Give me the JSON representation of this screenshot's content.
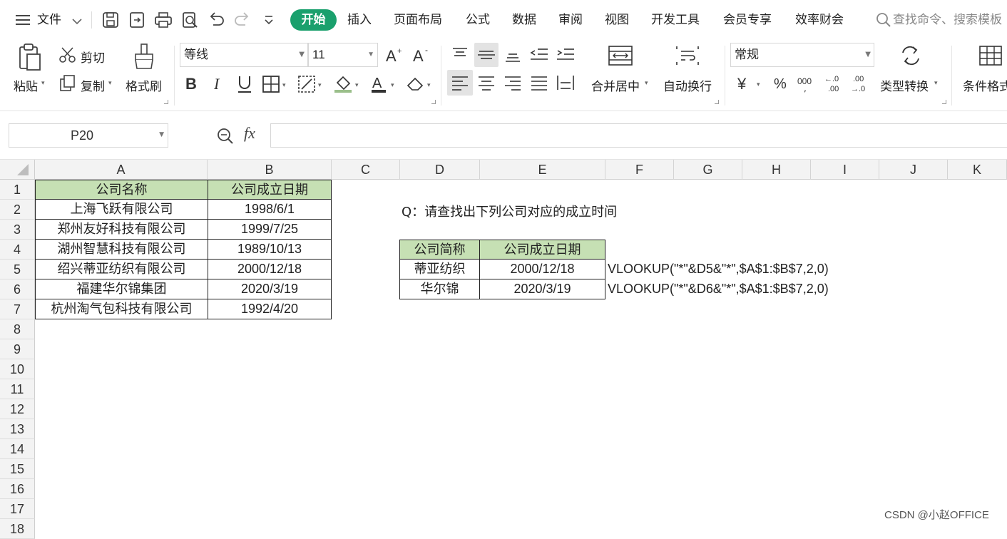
{
  "menu": {
    "file_label": "文件",
    "tabs": [
      "开始",
      "插入",
      "页面布局",
      "公式",
      "数据",
      "审阅",
      "视图",
      "开发工具",
      "会员专享",
      "效率财会"
    ],
    "search_placeholder": "查找命令、搜索模板"
  },
  "ribbon": {
    "paste": "粘贴",
    "cut": "剪切",
    "copy": "复制",
    "format_painter": "格式刷",
    "font_name": "等线",
    "font_size": "11",
    "merge_center": "合并居中",
    "wrap_text": "自动换行",
    "number_format": "常规",
    "type_convert": "类型转换",
    "conditional_format": "条件格式"
  },
  "formula_bar": {
    "name_box": "P20",
    "fx_label": "fx",
    "formula": ""
  },
  "sheet": {
    "columns": [
      "A",
      "B",
      "C",
      "D",
      "E",
      "F",
      "G",
      "H",
      "I",
      "J",
      "K"
    ],
    "rows": [
      "1",
      "2",
      "3",
      "4",
      "5",
      "6",
      "7",
      "8",
      "9",
      "10",
      "11",
      "12",
      "13",
      "14",
      "15",
      "16",
      "17",
      "18"
    ],
    "table1": {
      "headers": [
        "公司名称",
        "公司成立日期"
      ],
      "rows": [
        [
          "上海飞跃有限公司",
          "1998/6/1"
        ],
        [
          "郑州友好科技有限公司",
          "1999/7/25"
        ],
        [
          "湖州智慧科技有限公司",
          "1989/10/13"
        ],
        [
          "绍兴蒂亚纺织有限公司",
          "2000/12/18"
        ],
        [
          "福建华尔锦集团",
          "2020/3/19"
        ],
        [
          "杭州淘气包科技有限公司",
          "1992/4/20"
        ]
      ]
    },
    "question": "Q：请查找出下列公司对应的成立时间",
    "table2": {
      "headers": [
        "公司简称",
        "公司成立日期"
      ],
      "rows": [
        [
          "蒂亚纺织",
          "2000/12/18",
          "VLOOKUP(\"*\"&D5&\"*\",$A$1:$B$7,2,0)"
        ],
        [
          "华尔锦",
          "2020/3/19",
          "VLOOKUP(\"*\"&D6&\"*\",$A$1:$B$7,2,0)"
        ]
      ]
    },
    "header_fill": "#c6e0b4"
  },
  "watermark": "CSDN @小赵OFFICE",
  "colors": {
    "accent": "#1aa06d"
  }
}
